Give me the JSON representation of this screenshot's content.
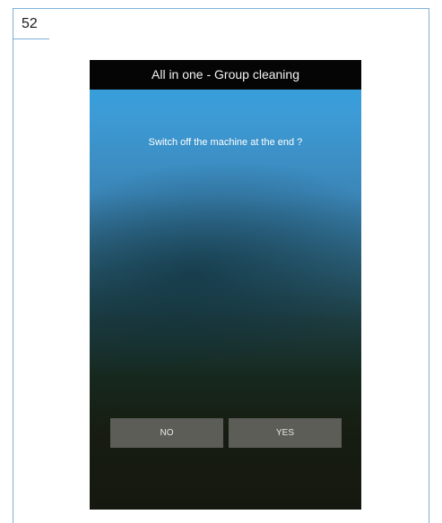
{
  "page": {
    "number": "52"
  },
  "screen": {
    "title": "All in one - Group cleaning",
    "prompt": "Switch off the machine at the end ?",
    "buttons": {
      "no_label": "NO",
      "yes_label": "YES"
    }
  },
  "colors": {
    "frame_border": "#7fb0d8",
    "title_bar_bg": "#050505",
    "button_bg": "#696964",
    "gradient_top": "#2ea3e0",
    "gradient_bottom": "#151810"
  }
}
